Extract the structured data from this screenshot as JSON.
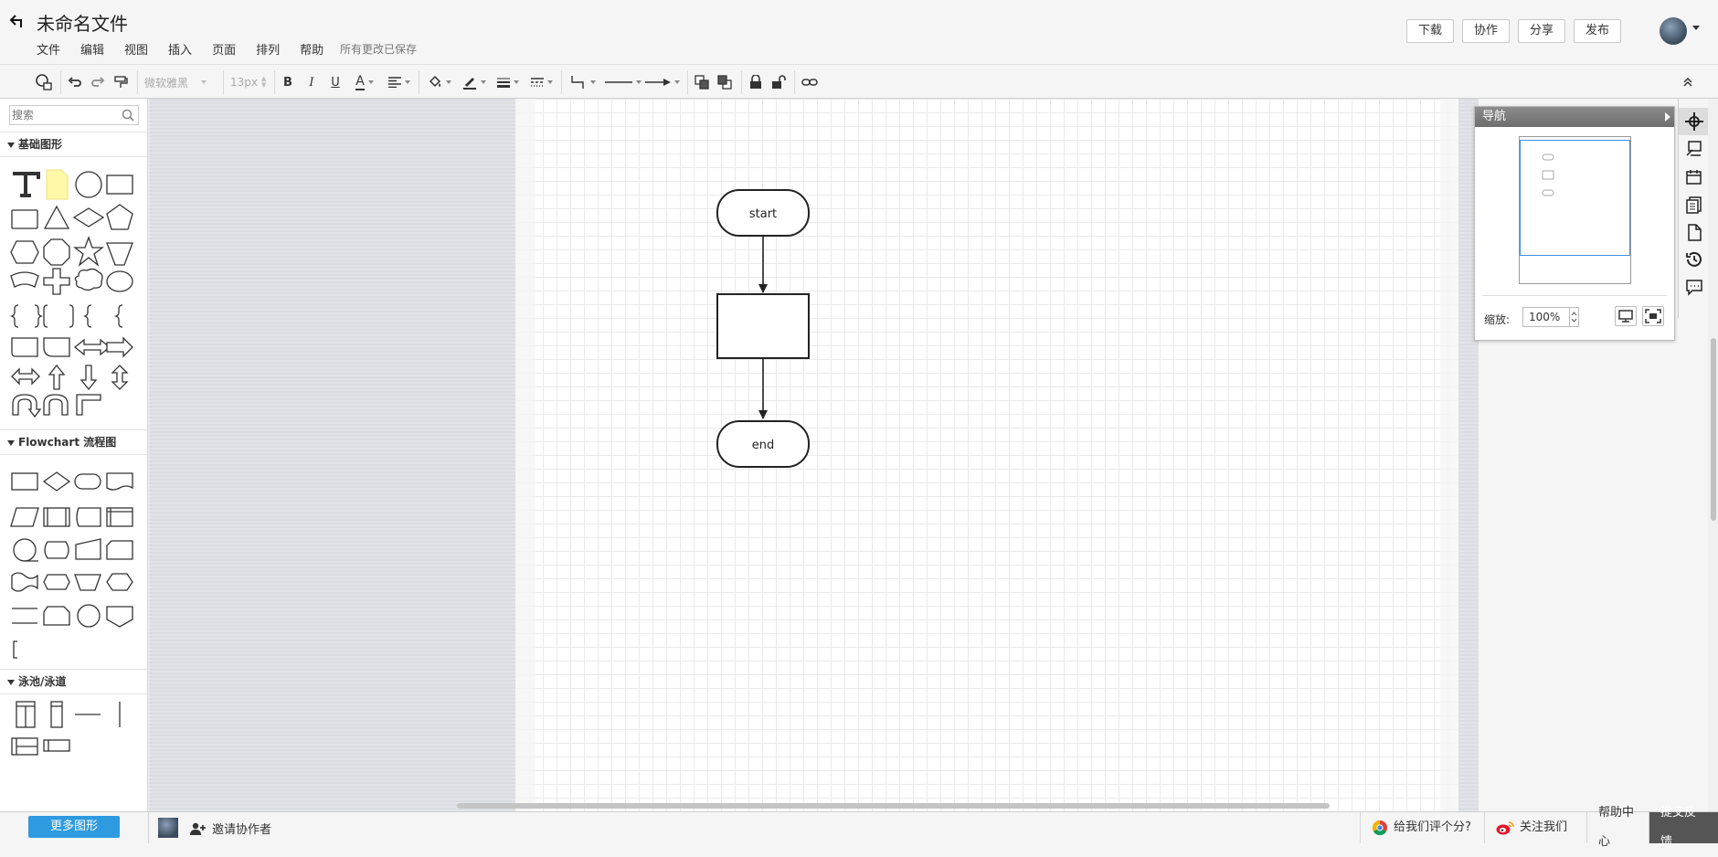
{
  "header": {
    "title": "未命名文件",
    "menu": [
      "文件",
      "编辑",
      "视图",
      "插入",
      "页面",
      "排列",
      "帮助"
    ],
    "save_status": "所有更改已保存",
    "actions": [
      "下载",
      "协作",
      "分享",
      "发布"
    ]
  },
  "toolbar": {
    "font_family": "微软雅黑",
    "font_size": "13px",
    "bold": "B",
    "italic": "I",
    "underline": "U",
    "font_color": "A"
  },
  "sidebar": {
    "search_placeholder": "搜索",
    "categories": [
      "基础图形",
      "Flowchart 流程图",
      "泳池/泳道"
    ],
    "more_shapes": "更多图形"
  },
  "diagram": {
    "nodes": [
      {
        "type": "terminal",
        "label": "start"
      },
      {
        "type": "process",
        "label": ""
      },
      {
        "type": "terminal",
        "label": "end"
      }
    ]
  },
  "navigator": {
    "title": "导航",
    "zoom_label": "缩放:",
    "zoom_value": "100%"
  },
  "footer": {
    "invite": "邀请协作者",
    "rate": "给我们评个分?",
    "follow": "关注我们",
    "help": "帮助中心",
    "feedback": "提交反馈"
  },
  "colors": {
    "accent": "#2e9ae0",
    "canvas_bg": "#dfe0e5",
    "feedback_bg": "#555555"
  }
}
